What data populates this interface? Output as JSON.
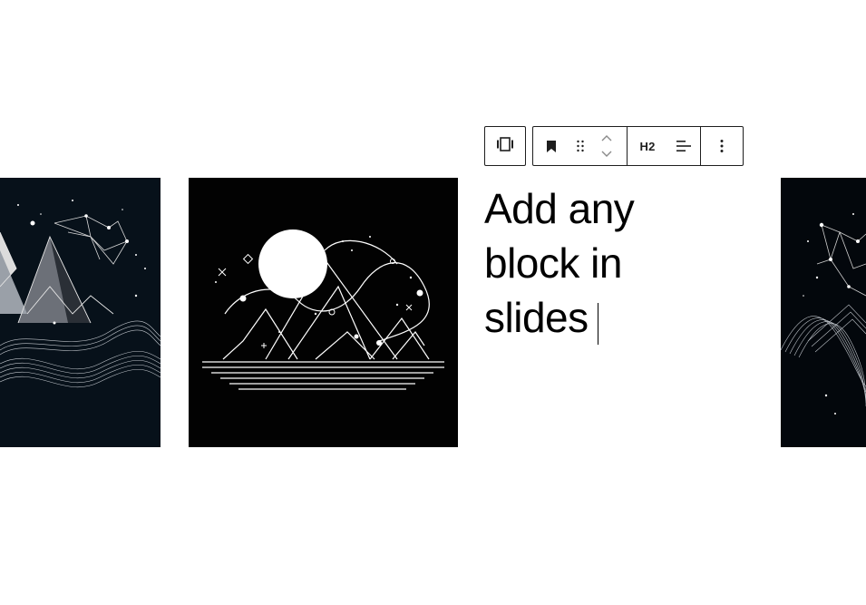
{
  "heading": {
    "lines": [
      "Add any",
      "block in",
      "slides"
    ]
  },
  "toolbar": {
    "carousel_icon": "carousel-icon",
    "bookmark_icon": "bookmark-icon",
    "drag_icon": "drag-handle-icon",
    "move_up_icon": "chevron-up-icon",
    "move_down_icon": "chevron-down-icon",
    "heading_level_label": "H2",
    "align_icon": "align-left-icon",
    "more_icon": "more-vertical-icon"
  },
  "slides": [
    {
      "id": "left",
      "content": "abstract-mountains-constellation-image"
    },
    {
      "id": "center",
      "content": "mountains-moon-line-art-image"
    },
    {
      "id": "right",
      "content": "abstract-wave-constellation-image"
    }
  ],
  "colors": {
    "background": "#ffffff",
    "toolbar_border": "#1e1e1e",
    "slide_dark": "#04070c",
    "text": "#000000"
  }
}
